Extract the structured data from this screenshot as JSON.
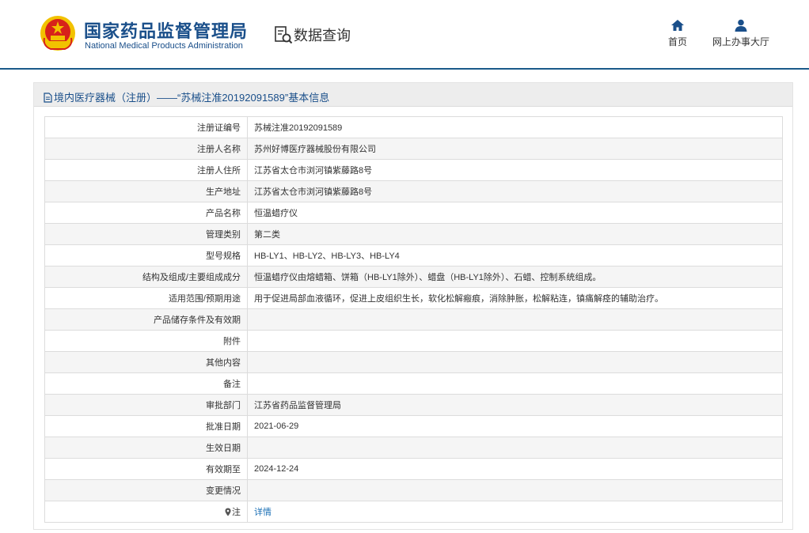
{
  "header": {
    "brand_cn": "国家药品监督管理局",
    "brand_en": "National Medical Products Administration",
    "query_title": "数据查询",
    "nav": [
      {
        "label": "首页",
        "icon": "home-icon"
      },
      {
        "label": "网上办事大厅",
        "icon": "user-icon"
      }
    ]
  },
  "panel": {
    "title": "境内医疗器械（注册）——“苏械注准20192091589”基本信息"
  },
  "rows": [
    {
      "key": "注册证编号",
      "value": "苏械注准20192091589"
    },
    {
      "key": "注册人名称",
      "value": "苏州好博医疗器械股份有限公司"
    },
    {
      "key": "注册人住所",
      "value": "江苏省太仓市浏河镇紫藤路8号"
    },
    {
      "key": "生产地址",
      "value": "江苏省太仓市浏河镇紫藤路8号"
    },
    {
      "key": "产品名称",
      "value": "恒温蜡疗仪"
    },
    {
      "key": "管理类别",
      "value": "第二类"
    },
    {
      "key": "型号规格",
      "value": "HB-LY1、HB-LY2、HB-LY3、HB-LY4"
    },
    {
      "key": "结构及组成/主要组成成分",
      "value": "恒温蜡疗仪由熔蜡箱、饼箱（HB-LY1除外）、蜡盘（HB-LY1除外）、石蜡、控制系统组成。"
    },
    {
      "key": "适用范围/预期用途",
      "value": "用于促进局部血液循环，促进上皮组织生长，软化松解瘢痕，消除肿胀，松解粘连，镇痛解痉的辅助治疗。"
    },
    {
      "key": "产品储存条件及有效期",
      "value": ""
    },
    {
      "key": "附件",
      "value": ""
    },
    {
      "key": "其他内容",
      "value": ""
    },
    {
      "key": "备注",
      "value": ""
    },
    {
      "key": "审批部门",
      "value": "江苏省药品监督管理局"
    },
    {
      "key": "批准日期",
      "value": "2021-06-29"
    },
    {
      "key": "生效日期",
      "value": ""
    },
    {
      "key": "有效期至",
      "value": "2024-12-24"
    },
    {
      "key": "变更情况",
      "value": ""
    }
  ],
  "note_row": {
    "key": "注",
    "link": "详情"
  },
  "colors": {
    "brand": "#1a4f8a",
    "link": "#1a6fb5",
    "divider": "#1a5a8a"
  }
}
